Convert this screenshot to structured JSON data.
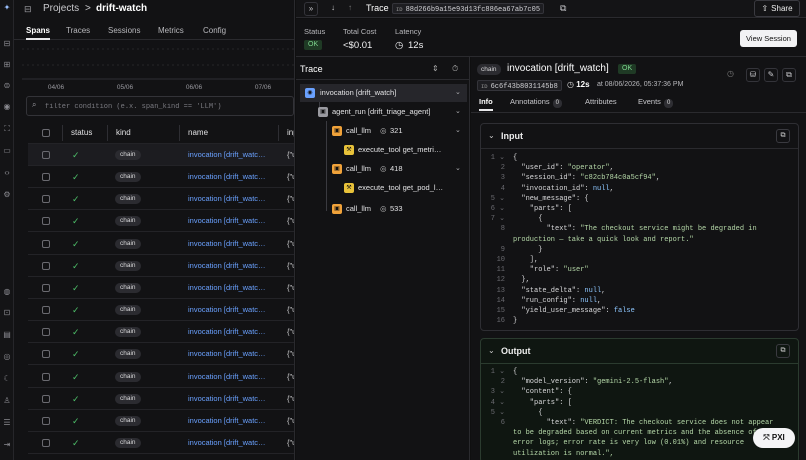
{
  "breadcrumb": {
    "root": "Projects",
    "separator": ">",
    "current": "drift-watch"
  },
  "left_tabs": [
    "Spans",
    "Traces",
    "Sessions",
    "Metrics",
    "Config"
  ],
  "chart_axis": {
    "ticks": [
      "04/06",
      "05/06",
      "06/06",
      "07/06"
    ]
  },
  "filter": {
    "placeholder": "filter condition (e.x. span_kind == 'LLM')"
  },
  "table": {
    "headers": [
      "status",
      "kind",
      "name",
      "input"
    ],
    "rows": [
      {
        "status": "ok",
        "kind": "chain",
        "name": "invocation [drift_watc…",
        "input": "{\"user"
      },
      {
        "status": "ok",
        "kind": "chain",
        "name": "invocation [drift_watc…",
        "input": "{\"user"
      },
      {
        "status": "ok",
        "kind": "chain",
        "name": "invocation [drift_watc…",
        "input": "{\"user"
      },
      {
        "status": "ok",
        "kind": "chain",
        "name": "invocation [drift_watc…",
        "input": "{\"user"
      },
      {
        "status": "ok",
        "kind": "chain",
        "name": "invocation [drift_watc…",
        "input": "{\"user"
      },
      {
        "status": "ok",
        "kind": "chain",
        "name": "invocation [drift_watc…",
        "input": "{\"user"
      },
      {
        "status": "ok",
        "kind": "chain",
        "name": "invocation [drift_watc…",
        "input": "{\"user"
      },
      {
        "status": "ok",
        "kind": "chain",
        "name": "invocation [drift_watc…",
        "input": "{\"user"
      },
      {
        "status": "ok",
        "kind": "chain",
        "name": "invocation [drift_watc…",
        "input": "{\"user"
      },
      {
        "status": "ok",
        "kind": "chain",
        "name": "invocation [drift_watc…",
        "input": "{\"user"
      },
      {
        "status": "ok",
        "kind": "chain",
        "name": "invocation [drift_watc…",
        "input": "{\"user"
      },
      {
        "status": "ok",
        "kind": "chain",
        "name": "invocation [drift_watc…",
        "input": "{\"user"
      },
      {
        "status": "ok",
        "kind": "chain",
        "name": "invocation [drift_watc…",
        "input": "{\"user"
      },
      {
        "status": "ok",
        "kind": "chain",
        "name": "invocation [drift_watc…",
        "input": "{\"user"
      },
      {
        "status": "ok",
        "kind": "chain",
        "name": "invocation [drift_watc…",
        "input": "{\"user"
      }
    ]
  },
  "trace_header": {
    "title": "Trace",
    "id_label": "ID",
    "trace_id": "88d266b9a15e93d13fc886ea67ab7c05",
    "share_label": "Share"
  },
  "stats": {
    "status_label": "Status",
    "status_value": "OK",
    "cost_label": "Total Cost",
    "cost_value": "<$0.01",
    "latency_label": "Latency",
    "latency_value": "12s",
    "view_session_label": "View Session"
  },
  "tree": {
    "title": "Trace",
    "nodes": [
      {
        "label": "invocation [drift_watch]",
        "kind": "chain"
      },
      {
        "label": "agent_run [drift_triage_agent]",
        "kind": "agent"
      },
      {
        "label": "call_llm",
        "kind": "llm",
        "tokens": "321"
      },
      {
        "label": "execute_tool get_metri…",
        "kind": "tool"
      },
      {
        "label": "call_llm",
        "kind": "llm",
        "tokens": "418"
      },
      {
        "label": "execute_tool get_pod_l…",
        "kind": "tool"
      },
      {
        "label": "call_llm",
        "kind": "llm",
        "tokens": "533"
      }
    ]
  },
  "detail": {
    "kind_badge": "chain",
    "title": "invocation [drift_watch]",
    "status_badge": "OK",
    "id_label": "ID",
    "span_id": "6c6f43b8031145b8",
    "latency": "12s",
    "timestamp": "at 08/06/2026, 05:37:36 PM",
    "tabs": [
      {
        "label": "Info"
      },
      {
        "label": "Annotations",
        "count": "0"
      },
      {
        "label": "Attributes"
      },
      {
        "label": "Events",
        "count": "0"
      }
    ],
    "input_title": "Input",
    "output_title": "Output",
    "pxi_label": "PXI"
  },
  "colors": {
    "accent_link": "#6aa1ff",
    "ok_green": "#4ec06a",
    "llm_orange": "#f0a23a",
    "tool_yellow": "#e8c23a",
    "chain_blue": "#6aa1ff"
  }
}
